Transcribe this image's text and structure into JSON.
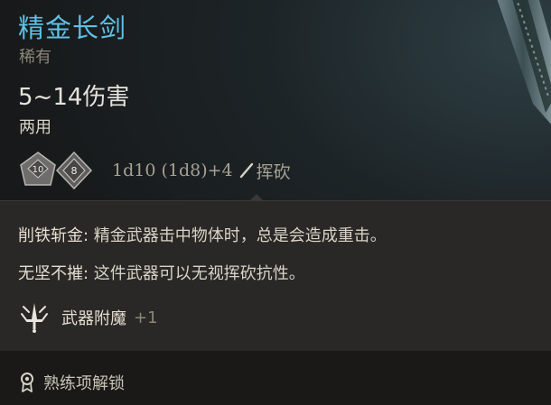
{
  "item": {
    "name": "精金长剑",
    "rarity": "稀有",
    "damage": "5~14伤害",
    "handedness": "两用"
  },
  "dice": {
    "die1_label": "10",
    "die2_label": "8",
    "formula": "1d10 (1d8)+4",
    "damage_type": "挥砍",
    "damage_type_icon": "slash-icon"
  },
  "passives": [
    {
      "name": "削铁斩金:",
      "text": " 精金武器击中物体时，总是会造成重击。"
    },
    {
      "name": "无坚不摧:",
      "text": " 这件武器可以无视挥砍抗性。"
    }
  ],
  "enchantment": {
    "label": "武器附魔",
    "bonus": "+1",
    "icon": "enchant-sword-icon"
  },
  "proficiency": {
    "label": "熟练项解锁",
    "icon": "proficiency-icon"
  },
  "colors": {
    "name": "#5fc0e6",
    "rarity": "#8c8778",
    "panel": "#2a2826"
  }
}
